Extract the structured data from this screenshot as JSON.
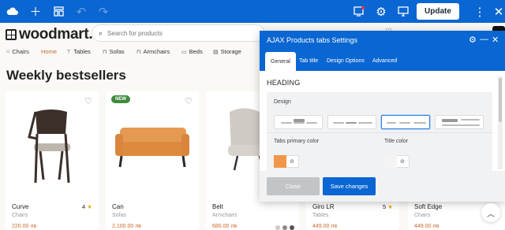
{
  "topbar": {
    "icons": [
      "cloud-icon",
      "plus-icon",
      "layout-icon",
      "undo-icon",
      "redo-icon",
      "notification-icon",
      "gear-icon",
      "screen-icon",
      "more-icon",
      "close-icon"
    ],
    "update_label": "Update",
    "color": "#0a66d2"
  },
  "site": {
    "logo_text": "woodmart.",
    "search_placeholder": "Search for products",
    "nav": [
      "Chairs",
      "Home",
      "Tables",
      "Sofas",
      "Armchairs",
      "Beds",
      "Storage"
    ],
    "active_nav": "Home",
    "heading": "Weekly bestsellers"
  },
  "products": [
    {
      "name": "Curve",
      "category": "Chairs",
      "price": "220.00 лв",
      "rating": "4",
      "badge": ""
    },
    {
      "name": "Can",
      "category": "Sofas",
      "price": "2,100.00 лв",
      "rating": "",
      "badge": "NEW"
    },
    {
      "name": "Belt",
      "category": "Armchairs",
      "price": "680.00 лв",
      "rating": "",
      "badge": ""
    },
    {
      "name": "Giro LR",
      "category": "Tables",
      "price": "449.00 лв",
      "rating": "5",
      "badge": ""
    },
    {
      "name": "Soft Edge",
      "category": "Chairs",
      "price": "449.00 лв",
      "rating": "",
      "badge": ""
    }
  ],
  "panel": {
    "title": "AJAX Products tabs Settings",
    "tabs": [
      "General",
      "Tab title",
      "Design Options",
      "Advanced"
    ],
    "active_tab": "General",
    "section_title": "HEADING",
    "design_label": "Design",
    "selected_design": 3,
    "tabs_primary_color_label": "Tabs primary color",
    "tabs_primary_color": "#f0974a",
    "title_color_label": "Title color",
    "title_color": "#f4f4f4",
    "close_label": "Close",
    "save_label": "Save changes"
  },
  "accent_color": "#c96b2c"
}
